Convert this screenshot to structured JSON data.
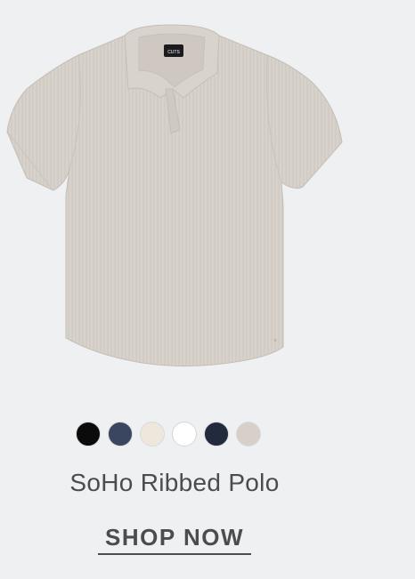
{
  "product": {
    "name": "SoHo Ribbed Polo",
    "image": {
      "label_icon": "cuts-logo-label",
      "shirt_color": "#d5d0c9"
    },
    "swatches": [
      {
        "name": "black",
        "color": "#0b0b0c"
      },
      {
        "name": "navy",
        "color": "#3a4560"
      },
      {
        "name": "cream",
        "color": "#efe6dc"
      },
      {
        "name": "white",
        "color": "#ffffff"
      },
      {
        "name": "dark-navy",
        "color": "#222b3d"
      },
      {
        "name": "stone",
        "color": "#d6d0c9"
      }
    ]
  },
  "cta": {
    "label": "SHOP NOW"
  }
}
